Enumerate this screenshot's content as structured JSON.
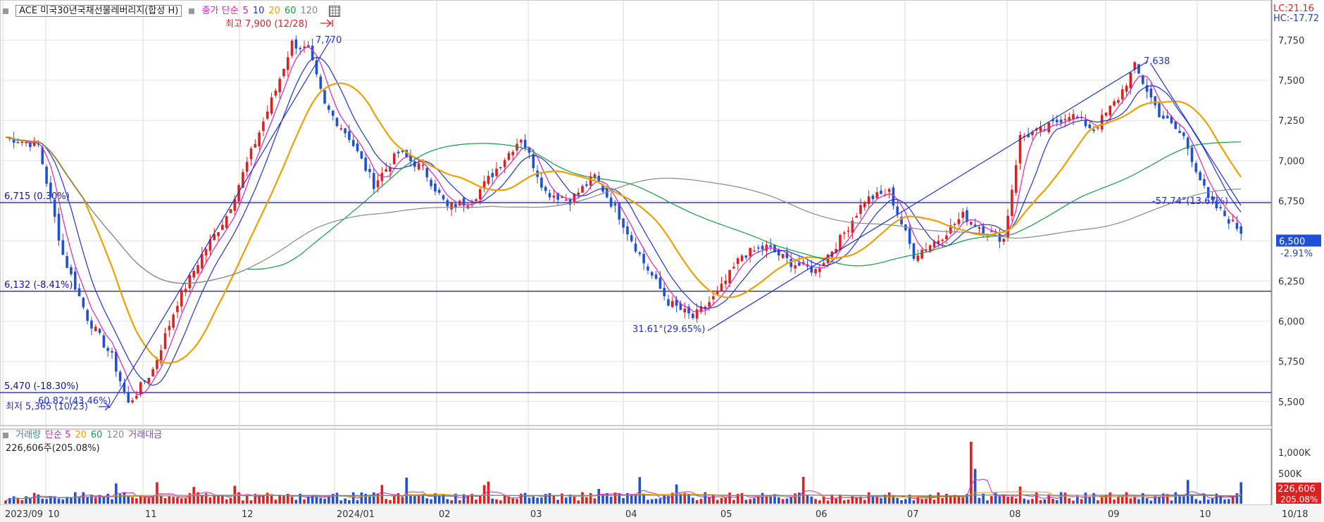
{
  "title": "ACE 미국30년국채선물레버리지(합성 H)",
  "legend_main": {
    "items": [
      {
        "text": "종가 단순",
        "color": "#e020c0"
      },
      {
        "text": "5",
        "color": "#e020c0"
      },
      {
        "text": "10",
        "color": "#2030e0"
      },
      {
        "text": "20",
        "color": "#f0a000"
      },
      {
        "text": "60",
        "color": "#10a040"
      },
      {
        "text": "120",
        "color": "#888888"
      }
    ]
  },
  "legend_volume": {
    "items": [
      {
        "text": "거래량",
        "color": "#4080d0"
      },
      {
        "text": "단순 5",
        "color": "#e020c0"
      },
      {
        "text": "20",
        "color": "#f0a000"
      },
      {
        "text": "60",
        "color": "#10a040"
      },
      {
        "text": "120",
        "color": "#888888"
      },
      {
        "text": "거래대금",
        "color": "#7050c0"
      }
    ],
    "volume_text": "226,606주(205.08%)"
  },
  "right_top": {
    "lc": "LC:21.16",
    "hc": "HC:-17.72"
  },
  "annotations": {
    "high": "최고 7,900 (12/28)",
    "low": "최저 5,365 (10/23)",
    "peak1": "7,770",
    "peak2": "7,638",
    "angle1": "60.82°(43.46%)",
    "angle2": "31.61°(29.65%)",
    "angle3": "-57.74°(13.67%)",
    "hline1": "6,715 (0.30%)",
    "hline2": "6,132 (-8.41%)",
    "hline3": "5,470 (-18.30%)"
  },
  "price_badge": {
    "value": "6,500",
    "pct": "-2.91%"
  },
  "volume_badge": {
    "value": "226,606",
    "pct": "205.08%"
  },
  "colors": {
    "up": "#e02020",
    "down": "#1f50d8",
    "ma5": "#e020c0",
    "ma10": "#2030e0",
    "ma20": "#f0a000",
    "ma60": "#10a040",
    "ma120": "#888888",
    "hline": "#1010c0"
  },
  "chart_data": {
    "type": "candlestick",
    "y_axis": {
      "ticks": [
        "7,750",
        "7,500",
        "7,250",
        "7,000",
        "6,750",
        "6,500",
        "6,250",
        "6,000",
        "5,750",
        "5,500"
      ],
      "range": [
        5350,
        8000
      ]
    },
    "volume_axis": {
      "ticks": [
        "1,000K",
        "500K"
      ]
    },
    "x_axis": {
      "labels": [
        "2023/09",
        "10",
        "11",
        "12",
        "2024/01",
        "02",
        "03",
        "04",
        "05",
        "06",
        "07",
        "08",
        "09",
        "10",
        "10/18"
      ]
    },
    "horizontal_lines": [
      6715,
      6132,
      5470
    ],
    "close_path": [
      {
        "t": 0,
        "v": 7100
      },
      {
        "t": 8,
        "v": 7050
      },
      {
        "t": 14,
        "v": 6350
      },
      {
        "t": 20,
        "v": 5950
      },
      {
        "t": 26,
        "v": 5700
      },
      {
        "t": 30,
        "v": 5400
      },
      {
        "t": 36,
        "v": 5620
      },
      {
        "t": 42,
        "v": 6050
      },
      {
        "t": 48,
        "v": 6350
      },
      {
        "t": 54,
        "v": 6600
      },
      {
        "t": 60,
        "v": 7000
      },
      {
        "t": 66,
        "v": 7400
      },
      {
        "t": 70,
        "v": 7700
      },
      {
        "t": 74,
        "v": 7650
      },
      {
        "t": 78,
        "v": 7300
      },
      {
        "t": 84,
        "v": 7100
      },
      {
        "t": 90,
        "v": 6800
      },
      {
        "t": 96,
        "v": 7000
      },
      {
        "t": 102,
        "v": 6900
      },
      {
        "t": 108,
        "v": 6650
      },
      {
        "t": 114,
        "v": 6700
      },
      {
        "t": 120,
        "v": 6900
      },
      {
        "t": 126,
        "v": 7100
      },
      {
        "t": 132,
        "v": 6750
      },
      {
        "t": 138,
        "v": 6700
      },
      {
        "t": 144,
        "v": 6850
      },
      {
        "t": 150,
        "v": 6600
      },
      {
        "t": 156,
        "v": 6300
      },
      {
        "t": 162,
        "v": 6050
      },
      {
        "t": 168,
        "v": 5950
      },
      {
        "t": 174,
        "v": 6100
      },
      {
        "t": 180,
        "v": 6350
      },
      {
        "t": 186,
        "v": 6400
      },
      {
        "t": 192,
        "v": 6300
      },
      {
        "t": 198,
        "v": 6250
      },
      {
        "t": 204,
        "v": 6450
      },
      {
        "t": 210,
        "v": 6700
      },
      {
        "t": 216,
        "v": 6750
      },
      {
        "t": 222,
        "v": 6350
      },
      {
        "t": 228,
        "v": 6450
      },
      {
        "t": 234,
        "v": 6600
      },
      {
        "t": 240,
        "v": 6500
      },
      {
        "t": 244,
        "v": 6450
      },
      {
        "t": 248,
        "v": 7100
      },
      {
        "t": 254,
        "v": 7150
      },
      {
        "t": 260,
        "v": 7250
      },
      {
        "t": 266,
        "v": 7150
      },
      {
        "t": 272,
        "v": 7350
      },
      {
        "t": 276,
        "v": 7550
      },
      {
        "t": 282,
        "v": 7250
      },
      {
        "t": 288,
        "v": 7100
      },
      {
        "t": 294,
        "v": 6700
      },
      {
        "t": 298,
        "v": 6600
      },
      {
        "t": 302,
        "v": 6500
      }
    ]
  }
}
